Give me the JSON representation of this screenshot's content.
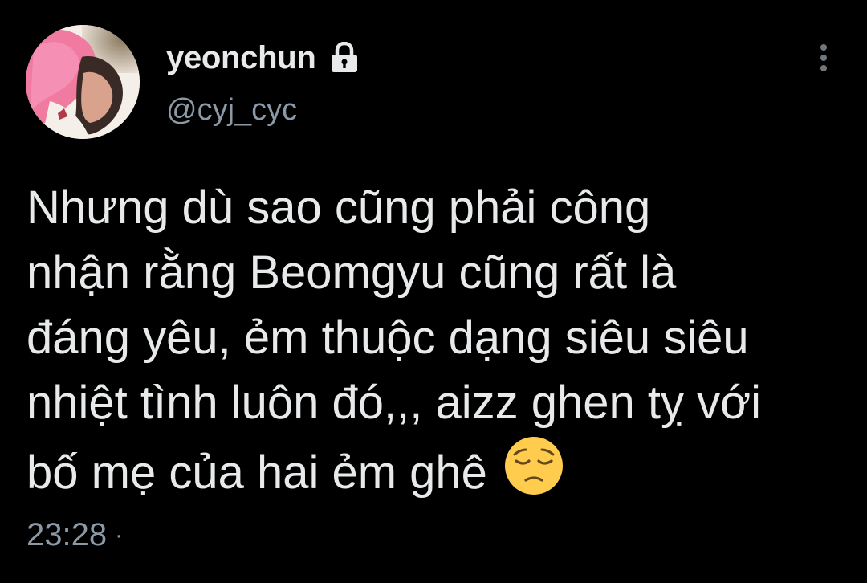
{
  "tweet": {
    "author": {
      "display_name": "yeonchun",
      "handle": "@cyj_cyc",
      "protected_icon": "lock-icon",
      "avatar": "profile-photo"
    },
    "body_lines": [
      "Nhưng dù sao cũng phải công",
      "nhận rằng Beomgyu cũng rất là",
      "đáng yêu, ẻm thuộc dạng siêu siêu",
      "nhiệt tình luôn đó,,, aizz ghen tỵ với",
      "bố mẹ của hai ẻm ghê"
    ],
    "emoji": "pensive-face",
    "timestamp": "23:28",
    "separator": "·",
    "menu_icon": "more-vertical-icon"
  },
  "colors": {
    "background": "#000000",
    "primary_text": "#e7e9ea",
    "secondary_text": "#8b98a5"
  }
}
